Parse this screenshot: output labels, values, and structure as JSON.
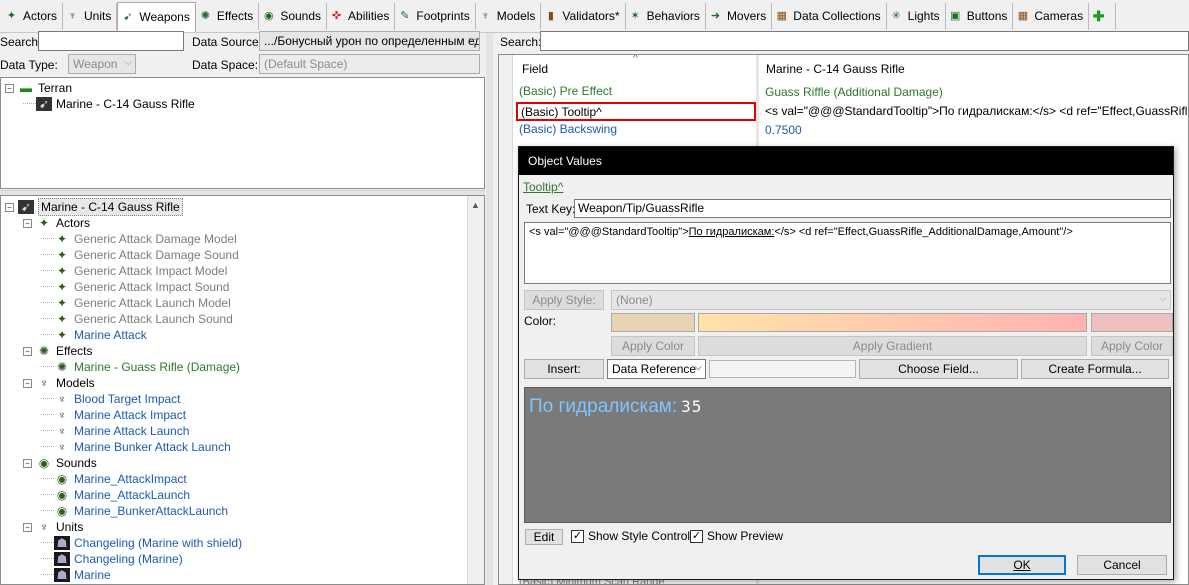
{
  "tabs": [
    {
      "label": "Actors",
      "icon": "actor-icon",
      "glyph": "✦"
    },
    {
      "label": "Units",
      "icon": "unit-icon",
      "glyph": "♆"
    },
    {
      "label": "Weapons",
      "icon": "weapon-icon",
      "glyph": "➹",
      "active": true
    },
    {
      "label": "Effects",
      "icon": "effect-icon",
      "glyph": "✺"
    },
    {
      "label": "Sounds",
      "icon": "sound-icon",
      "glyph": "◉"
    },
    {
      "label": "Abilities",
      "icon": "ability-icon",
      "glyph": "✜"
    },
    {
      "label": "Footprints",
      "icon": "footprint-icon",
      "glyph": "✎"
    },
    {
      "label": "Models",
      "icon": "model-icon",
      "glyph": "♆"
    },
    {
      "label": "Validators*",
      "icon": "validator-icon",
      "glyph": "▮"
    },
    {
      "label": "Behaviors",
      "icon": "behavior-icon",
      "glyph": "✶"
    },
    {
      "label": "Movers",
      "icon": "mover-icon",
      "glyph": "➜"
    },
    {
      "label": "Data Collections",
      "icon": "data-collection-icon",
      "glyph": "▦"
    },
    {
      "label": "Lights",
      "icon": "light-icon",
      "glyph": "✳"
    },
    {
      "label": "Buttons",
      "icon": "button-icon",
      "glyph": "▣"
    },
    {
      "label": "Cameras",
      "icon": "camera-icon",
      "glyph": "▦"
    },
    {
      "label": "",
      "icon": "add-tab-icon",
      "glyph": "✚"
    }
  ],
  "left": {
    "search_label": "Search:",
    "search_value": "",
    "data_source_label": "Data Source:",
    "data_source_value": ".../Бонусный урон по определенным ед",
    "data_type_label": "Data Type:",
    "data_type_value": "Weapon",
    "data_space_label": "Data Space:",
    "data_space_value": "(Default Space)",
    "top_tree": [
      {
        "label": "Terran",
        "level": 0,
        "expander": "−",
        "icon": "folder-icon",
        "glyph": "▬"
      },
      {
        "label": "Marine - C-14 Gauss Rifle",
        "level": 1,
        "icon": "weapon-icon",
        "glyph": "➹"
      }
    ],
    "bottom_tree": [
      {
        "label": "Marine - C-14 Gauss Rifle",
        "level": 0,
        "expander": "−",
        "icon": "weapon-icon",
        "glyph": "➹",
        "cls": "",
        "sel": true
      },
      {
        "label": "Actors",
        "level": 1,
        "expander": "−",
        "icon": "actor-icon",
        "glyph": "✦",
        "cls": ""
      },
      {
        "label": "Generic Attack Damage Model",
        "level": 2,
        "icon": "actor-icon",
        "glyph": "✦",
        "cls": "gray"
      },
      {
        "label": "Generic Attack Damage Sound",
        "level": 2,
        "icon": "actor-icon",
        "glyph": "✦",
        "cls": "gray"
      },
      {
        "label": "Generic Attack Impact Model",
        "level": 2,
        "icon": "actor-icon",
        "glyph": "✦",
        "cls": "gray"
      },
      {
        "label": "Generic Attack Impact Sound",
        "level": 2,
        "icon": "actor-icon",
        "glyph": "✦",
        "cls": "gray"
      },
      {
        "label": "Generic Attack Launch Model",
        "level": 2,
        "icon": "actor-icon",
        "glyph": "✦",
        "cls": "gray"
      },
      {
        "label": "Generic Attack Launch Sound",
        "level": 2,
        "icon": "actor-icon",
        "glyph": "✦",
        "cls": "gray"
      },
      {
        "label": "Marine Attack",
        "level": 2,
        "icon": "actor-icon",
        "glyph": "✦",
        "cls": "blue"
      },
      {
        "label": "Effects",
        "level": 1,
        "expander": "−",
        "icon": "effect-icon",
        "glyph": "✺",
        "cls": ""
      },
      {
        "label": "Marine - Guass Rifle (Damage)",
        "level": 2,
        "icon": "effect-icon",
        "glyph": "✺",
        "cls": "green"
      },
      {
        "label": "Models",
        "level": 1,
        "expander": "−",
        "icon": "model-icon",
        "glyph": "♆",
        "cls": ""
      },
      {
        "label": "Blood Target Impact",
        "level": 2,
        "icon": "model-icon",
        "glyph": "♆",
        "cls": "blue"
      },
      {
        "label": "Marine Attack Impact",
        "level": 2,
        "icon": "model-icon",
        "glyph": "♆",
        "cls": "blue"
      },
      {
        "label": "Marine Attack Launch",
        "level": 2,
        "icon": "model-icon",
        "glyph": "♆",
        "cls": "blue"
      },
      {
        "label": "Marine Bunker Attack Launch",
        "level": 2,
        "icon": "model-icon",
        "glyph": "♆",
        "cls": "blue"
      },
      {
        "label": "Sounds",
        "level": 1,
        "expander": "−",
        "icon": "sound-icon",
        "glyph": "◉",
        "cls": ""
      },
      {
        "label": "Marine_AttackImpact",
        "level": 2,
        "icon": "sound-icon",
        "glyph": "◉",
        "cls": "blue"
      },
      {
        "label": "Marine_AttackLaunch",
        "level": 2,
        "icon": "sound-icon",
        "glyph": "◉",
        "cls": "blue"
      },
      {
        "label": "Marine_BunkerAttackLaunch",
        "level": 2,
        "icon": "sound-icon",
        "glyph": "◉",
        "cls": "blue"
      },
      {
        "label": "Units",
        "level": 1,
        "expander": "−",
        "icon": "unit-icon",
        "glyph": "♆",
        "cls": ""
      },
      {
        "label": "Changeling (Marine with shield)",
        "level": 2,
        "icon": "unit-portrait-icon",
        "glyph": "☗",
        "cls": "blue"
      },
      {
        "label": "Changeling (Marine)",
        "level": 2,
        "icon": "unit-portrait-icon",
        "glyph": "☗",
        "cls": "blue"
      },
      {
        "label": "Marine",
        "level": 2,
        "icon": "unit-portrait-icon",
        "glyph": "☗",
        "cls": "blue"
      }
    ]
  },
  "right": {
    "search_label": "Search:",
    "search_value": "",
    "field_header": "Field",
    "value_header": "Marine - C-14 Gauss Rifle",
    "rows": [
      {
        "field": "(Basic) Pre Effect",
        "value": "Guass Riffle (Additional Damage)",
        "fcls": "green",
        "vcls": "green"
      },
      {
        "field": "(Basic) Tooltip^",
        "value": "<s val=\"@@@StandardTooltip\">По гидралискам:</s> <d ref=\"Effect,GuassRifle_Additio",
        "fcls": "",
        "vcls": "",
        "highlight": true
      },
      {
        "field": "(Basic) Backswing",
        "value": "0.7500",
        "fcls": "blue",
        "vcls": "blue"
      }
    ],
    "bottom_partial_field": "(Basic) Minimum Scan Range"
  },
  "dialog": {
    "title": "Object Values",
    "link": "Tooltip^",
    "text_key_label": "Text Key:",
    "text_key_value": "Weapon/Tip/GuassRifle",
    "text_prefix": "<s val=\"@@@StandardTooltip\">",
    "text_underlined": "По гидралискам:",
    "text_suffix": "</s> <d ref=\"Effect,GuassRifle_AdditionalDamage,Amount\"/>",
    "apply_style_label": "Apply Style:",
    "apply_style_value": "(None)",
    "color_label": "Color:",
    "apply_color_label": "Apply Color",
    "apply_gradient_label": "Apply Gradient",
    "apply_color2_label": "Apply Color",
    "insert_label": "Insert:",
    "insert_value": "Data Reference",
    "choose_field_label": "Choose Field...",
    "create_formula_label": "Create Formula...",
    "preview_text": "По гидралискам:",
    "preview_value": "35",
    "edit_label": "Edit",
    "show_style_controls_label": "Show Style Controls",
    "show_preview_label": "Show Preview",
    "ok_label": "OK",
    "cancel_label": "Cancel",
    "colors": {
      "swatch1": "#e6d3b3",
      "gradient_start": "#ffe2a8",
      "gradient_end": "#ffb3b3",
      "swatch2": "#efbfbf",
      "preview_bg": "#7a7a7a",
      "preview_text": "#7fc4ff",
      "highlight": "#e00000"
    }
  }
}
